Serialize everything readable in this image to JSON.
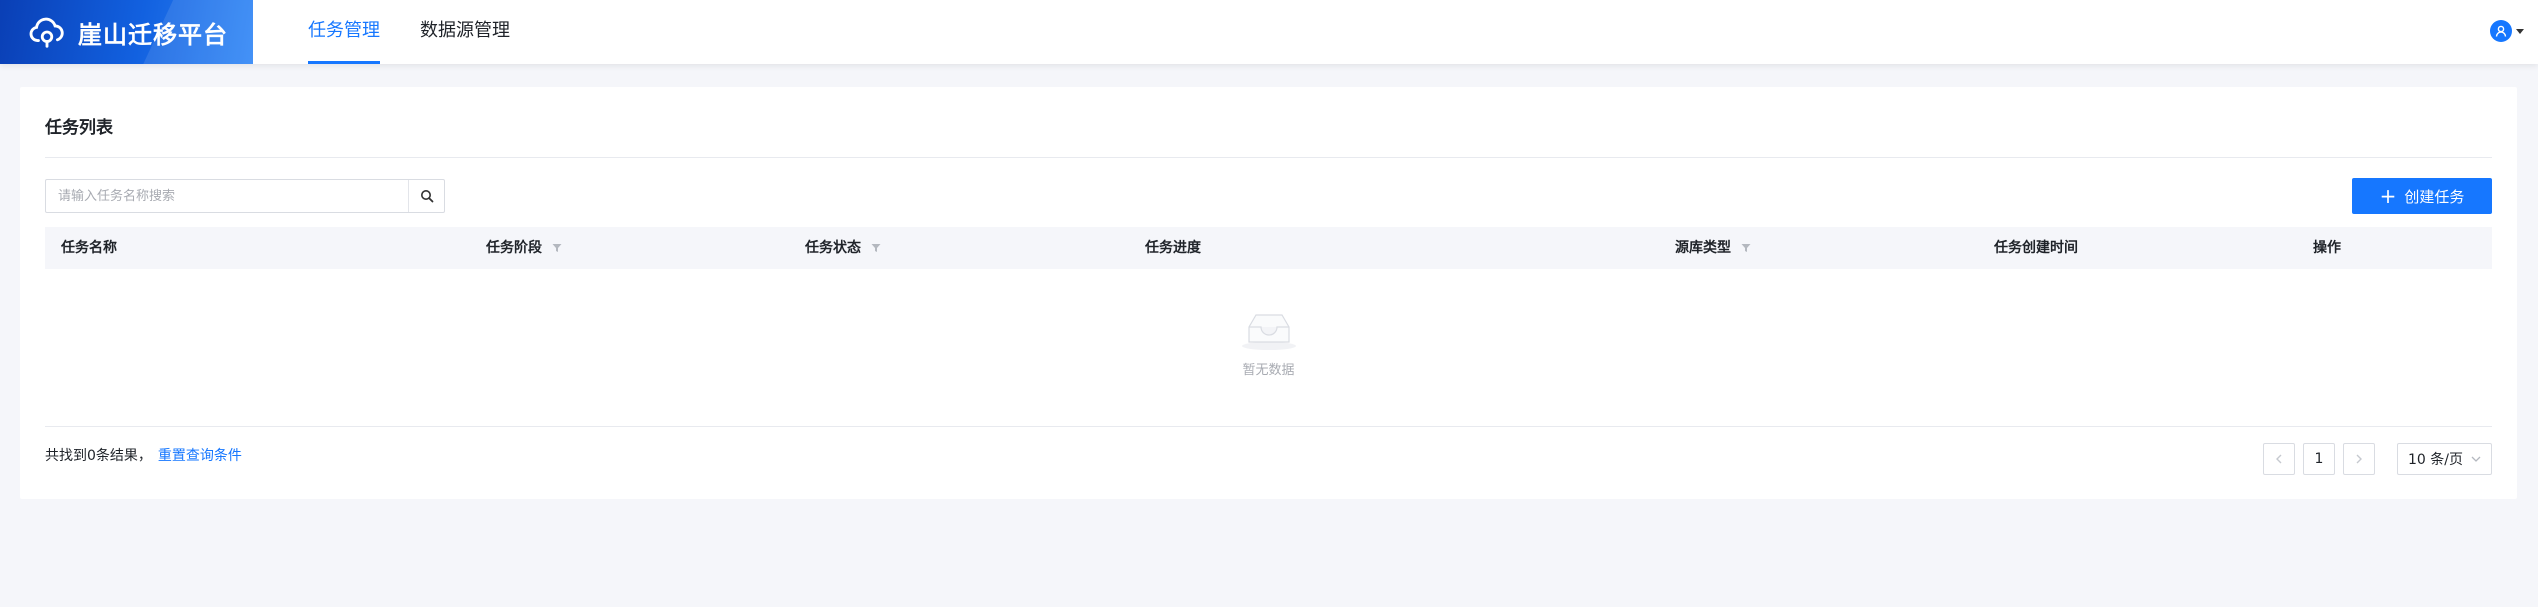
{
  "brand": {
    "title": "崖山迁移平台"
  },
  "nav": {
    "tabs": [
      {
        "label": "任务管理",
        "active": true
      },
      {
        "label": "数据源管理",
        "active": false
      }
    ]
  },
  "user": {
    "icon": "user-icon"
  },
  "task_list": {
    "title": "任务列表",
    "search": {
      "placeholder": "请输入任务名称搜索",
      "value": ""
    },
    "create_button_label": "创建任务",
    "columns": [
      {
        "label": "任务名称",
        "filter": false
      },
      {
        "label": "任务阶段",
        "filter": true
      },
      {
        "label": "任务状态",
        "filter": true
      },
      {
        "label": "任务进度",
        "filter": false
      },
      {
        "label": "源库类型",
        "filter": true
      },
      {
        "label": "任务创建时间",
        "filter": false
      },
      {
        "label": "操作",
        "filter": false
      }
    ],
    "rows": [],
    "empty_text": "暂无数据"
  },
  "footer": {
    "result_text": "共找到0条结果，",
    "reset_link": "重置查询条件",
    "pagination": {
      "current_page": "1",
      "page_size": "10 条/页"
    }
  },
  "colors": {
    "primary": "#1677ff",
    "brand_gradient_start": "#0a3fb5",
    "brand_gradient_end": "#2f86f6"
  }
}
